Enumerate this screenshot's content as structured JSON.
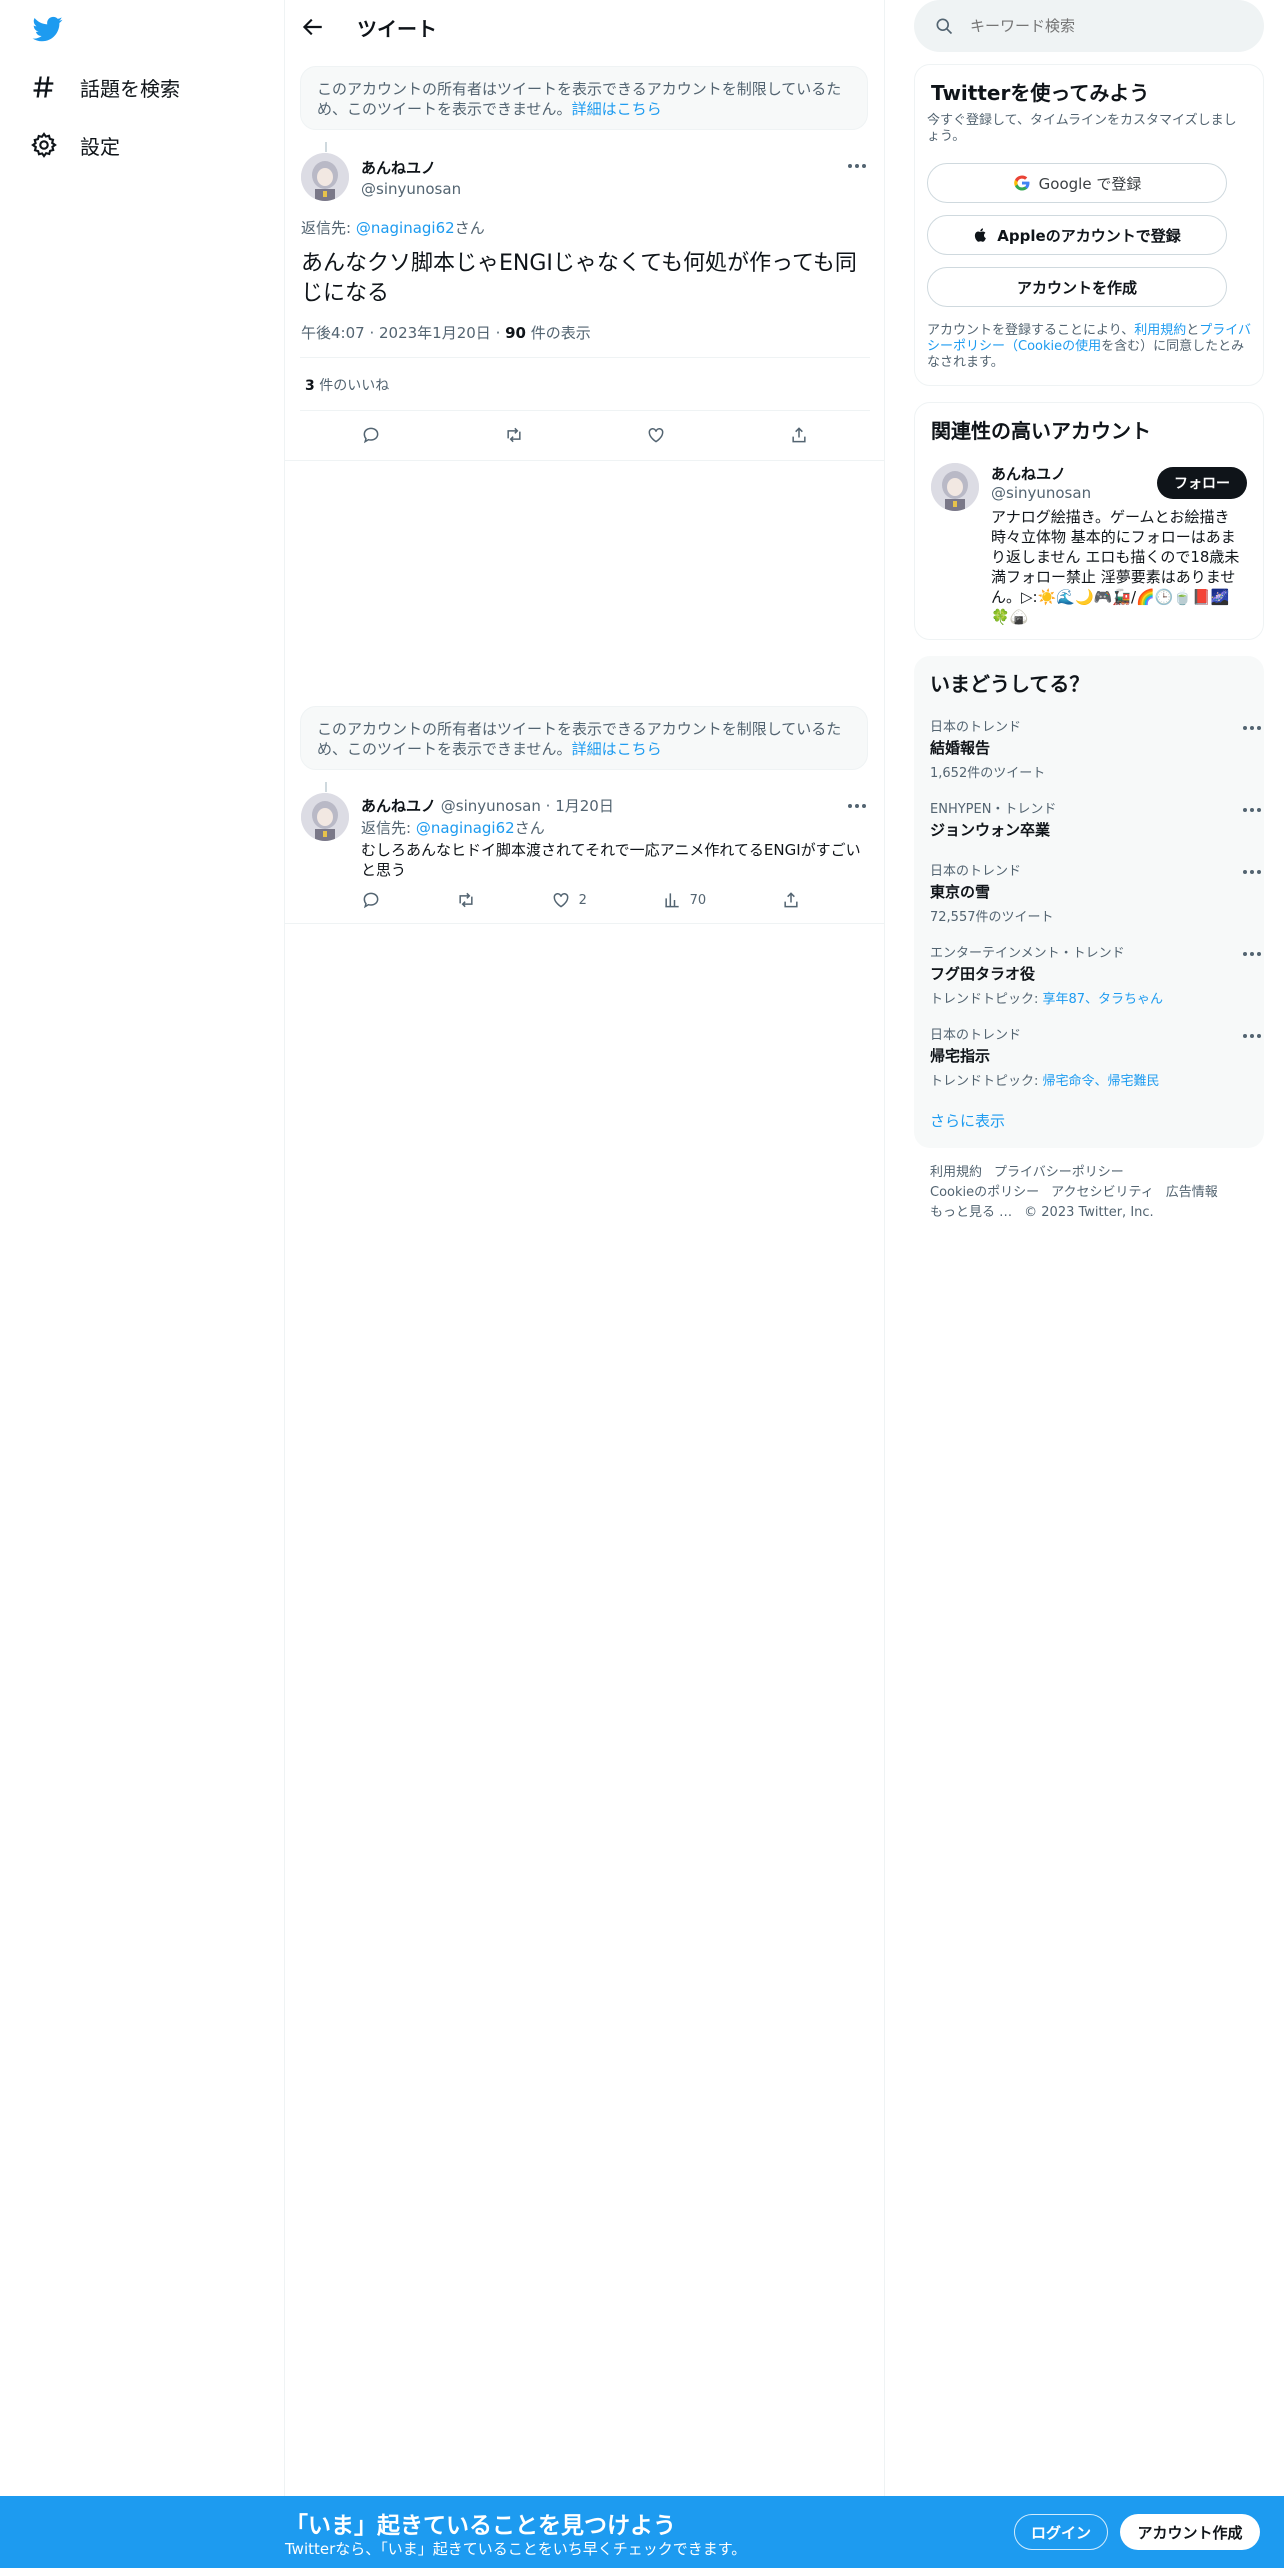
{
  "colors": {
    "accent": "#1d9bf0",
    "text": "#0f1419",
    "muted": "#536471",
    "border": "#eff3f4"
  },
  "nav": {
    "items": [
      {
        "icon": "hashtag-icon",
        "label": "話題を検索"
      },
      {
        "icon": "gear-icon",
        "label": "設定"
      }
    ]
  },
  "header": {
    "title": "ツイート"
  },
  "notice": {
    "text": "このアカウントの所有者はツイートを表示できるアカウントを制限しているため、このツイートを表示できません。",
    "link": "詳細はこちら"
  },
  "tweet": {
    "name": "あんねユノ",
    "handle": "@sinyunosan",
    "reply_prefix": "返信先: ",
    "reply_to": "@naginagi62",
    "reply_suffix": "さん",
    "text": "あんなクソ脚本じゃENGIじゃなくても何処が作っても同じになる",
    "time": "午後4:07",
    "date": "2023年1月20日",
    "views_count": "90",
    "views_label": "件の表示",
    "likes_count": "3",
    "likes_label": "件のいいね"
  },
  "reply": {
    "name": "あんねユノ",
    "handle": "@sinyunosan",
    "date": "1月20日",
    "reply_prefix": "返信先: ",
    "reply_to": "@naginagi62",
    "reply_suffix": "さん",
    "text": "むしろあんなヒドイ脚本渡されてそれで一応アニメ作れてるENGIがすごいと思う",
    "likes": "2",
    "views": "70"
  },
  "search": {
    "placeholder": "キーワード検索"
  },
  "signup": {
    "title": "Twitterを使ってみよう",
    "subtitle": "今すぐ登録して、タイムラインをカスタマイズしましょう。",
    "google": "Google で登録",
    "apple": "Appleのアカウントで登録",
    "create": "アカウントを作成",
    "terms_pre": "アカウントを登録することにより、",
    "terms_link1": "利用規約",
    "terms_and": "と",
    "terms_link2": "プライバシーポリシー（Cookieの使用",
    "terms_post": "を含む）に同意したとみなされます。"
  },
  "relevant": {
    "title": "関連性の高いアカウント",
    "name": "あんねユノ",
    "handle": "@sinyunosan",
    "follow": "フォロー",
    "bio": "アナログ絵描き。ゲームとお絵描き時々立体物 基本的にフォローはあまり返しません エロも描くので18歳未満フォロー禁止 淫夢要素はありません。▷:☀️🌊🌙🎮🚂/🌈🕒🍵📕🌌🍀🍙"
  },
  "trends": {
    "title": "いまどうしてる？",
    "items": [
      {
        "meta": "日本のトレンド",
        "name": "結婚報告",
        "sub": "1,652件のツイート",
        "topics": ""
      },
      {
        "meta": "ENHYPEN・トレンド",
        "name": "ジョンウォン卒業",
        "sub": "",
        "topics": ""
      },
      {
        "meta": "日本のトレンド",
        "name": "東京の雪",
        "sub": "72,557件のツイート",
        "topics": ""
      },
      {
        "meta": "エンターテインメント・トレンド",
        "name": "フグ田タラオ役",
        "sub": "トレンドトピック: ",
        "topics": "享年87、タラちゃん"
      },
      {
        "meta": "日本のトレンド",
        "name": "帰宅指示",
        "sub": "トレンドトピック: ",
        "topics": "帰宅命令、帰宅難民"
      }
    ],
    "show_more": "さらに表示"
  },
  "footer": {
    "links": [
      "利用規約",
      "プライバシーポリシー",
      "Cookieのポリシー",
      "アクセシビリティ",
      "広告情報",
      "もっと見る …",
      "© 2023 Twitter, Inc."
    ]
  },
  "banner": {
    "title": "「いま」起きていることを見つけよう",
    "subtitle": "Twitterなら、「いま」起きていることをいち早くチェックできます。",
    "login": "ログイン",
    "signup": "アカウント作成"
  }
}
